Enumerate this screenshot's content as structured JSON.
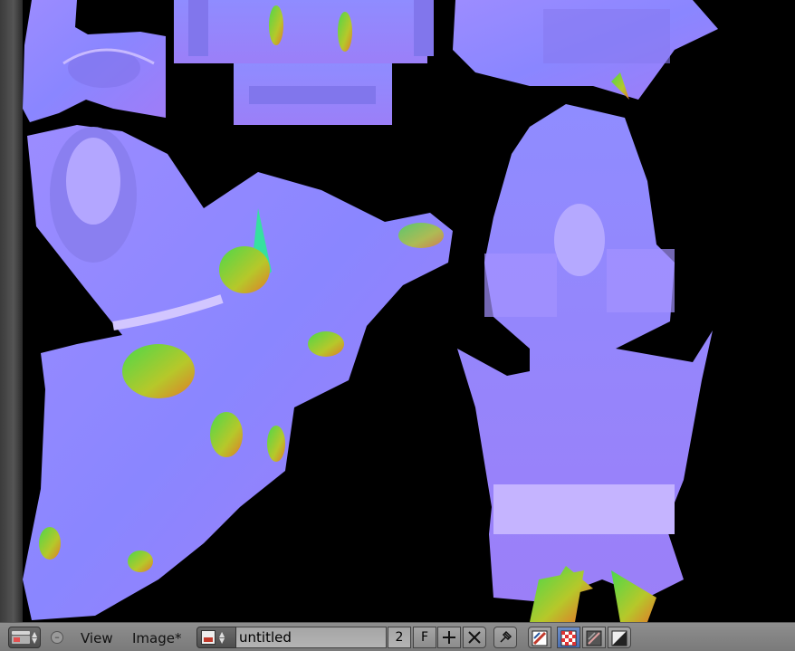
{
  "header": {
    "editor_type_icon": "image-editor-icon",
    "collapse_icon": "minus-circle-icon",
    "menu": {
      "view": "View",
      "image": "Image*"
    },
    "image": {
      "browse_icon": "image-browse-icon",
      "name": "untitled",
      "users": "2",
      "fake_user": "F",
      "new_icon": "plus-icon",
      "unlink_icon": "x-icon"
    },
    "pin_icon": "pin-icon",
    "mode_icons": [
      "paint-brush-icon",
      "checker-icon",
      "mask-icon",
      "contrast-icon"
    ]
  },
  "viewport": {
    "content": "normal-map texture"
  }
}
